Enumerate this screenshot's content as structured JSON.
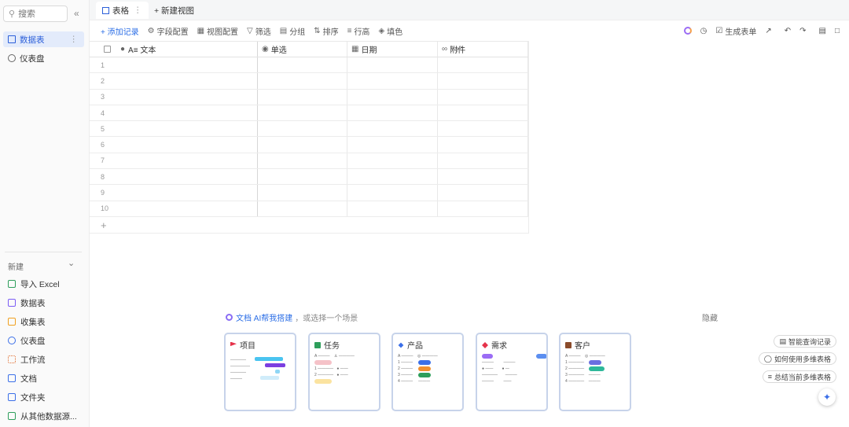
{
  "sidebar": {
    "search_placeholder": "搜索",
    "collapse": "«",
    "items": [
      {
        "label": "数据表",
        "more": "⋮"
      },
      {
        "label": "仪表盘"
      }
    ],
    "new_label": "新建",
    "new_items": [
      {
        "label": "导入 Excel",
        "color": "#2e9e5b"
      },
      {
        "label": "数据表",
        "color": "#7b5cf5"
      },
      {
        "label": "收集表",
        "color": "#f0a020"
      },
      {
        "label": "仪表盘",
        "color": "#3b6fe8"
      },
      {
        "label": "工作流",
        "color": "#e06a2b"
      },
      {
        "label": "文档",
        "color": "#3b6fe8"
      },
      {
        "label": "文件夹",
        "color": "#3b6fe8"
      },
      {
        "label": "从其他数据源...",
        "color": "#2e9e5b"
      }
    ]
  },
  "tabs": {
    "active": "表格",
    "active_more": "⋮",
    "new_view": "+ 新建视图"
  },
  "toolbar": {
    "add_record": "+ 添加记录",
    "field_config": "字段配置",
    "view_config": "视图配置",
    "filter": "筛选",
    "group": "分组",
    "sort": "排序",
    "row_height": "行高",
    "fill": "填色",
    "generate_form": "生成表单"
  },
  "grid": {
    "columns": [
      "A≡ 文本",
      "单选",
      "日期",
      "附件"
    ],
    "rows": [
      "1",
      "2",
      "3",
      "4",
      "5",
      "6",
      "7",
      "8",
      "9",
      "10"
    ],
    "add_col": "+",
    "add_row": "+"
  },
  "templates": {
    "ai_link": "文档 AI帮我搭建",
    "ai_rest": "，或选择一个场景",
    "hide": "隐藏",
    "cards": [
      {
        "title": "项目",
        "color": "#e5334b"
      },
      {
        "title": "任务",
        "color": "#2e9e5b"
      },
      {
        "title": "产品",
        "color": "#3b6fe8"
      },
      {
        "title": "需求",
        "color": "#e5334b"
      },
      {
        "title": "客户",
        "color": "#8a4b2b"
      }
    ]
  },
  "side_actions": {
    "smart_query": "智能查询记录",
    "how_to": "如何使用多维表格",
    "summary": "总结当前多维表格",
    "fab": "✦"
  }
}
